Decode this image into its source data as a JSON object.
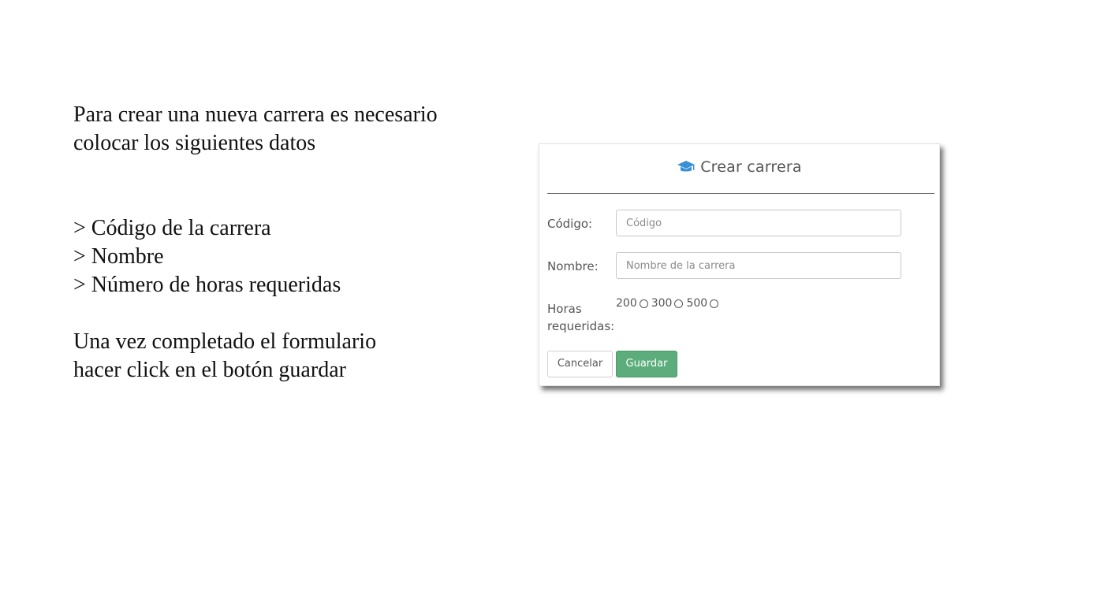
{
  "instructions": {
    "intro_line1": "Para crear una nueva carrera es necesario",
    "intro_line2": "colocar los siguientes datos",
    "items": [
      "> Código de la carrera",
      "> Nombre",
      "> Número de horas requeridas"
    ],
    "outro_line1": "Una vez completado el formulario",
    "outro_line2": "hacer click en el botón guardar"
  },
  "form": {
    "title": "Crear carrera",
    "title_icon": "graduation-cap-icon",
    "icon_color": "#3a8fd6",
    "codigo": {
      "label": "Código:",
      "value": "",
      "placeholder": "Código"
    },
    "nombre": {
      "label": "Nombre:",
      "value": "",
      "placeholder": "Nombre de la carrera"
    },
    "horas": {
      "label_line1": "Horas",
      "label_line2": "requeridas:",
      "options": [
        "200",
        "300",
        "500"
      ],
      "selected": null
    },
    "buttons": {
      "cancel_label": "Cancelar",
      "save_label": "Guardar",
      "save_color": "#5cad7b"
    }
  }
}
